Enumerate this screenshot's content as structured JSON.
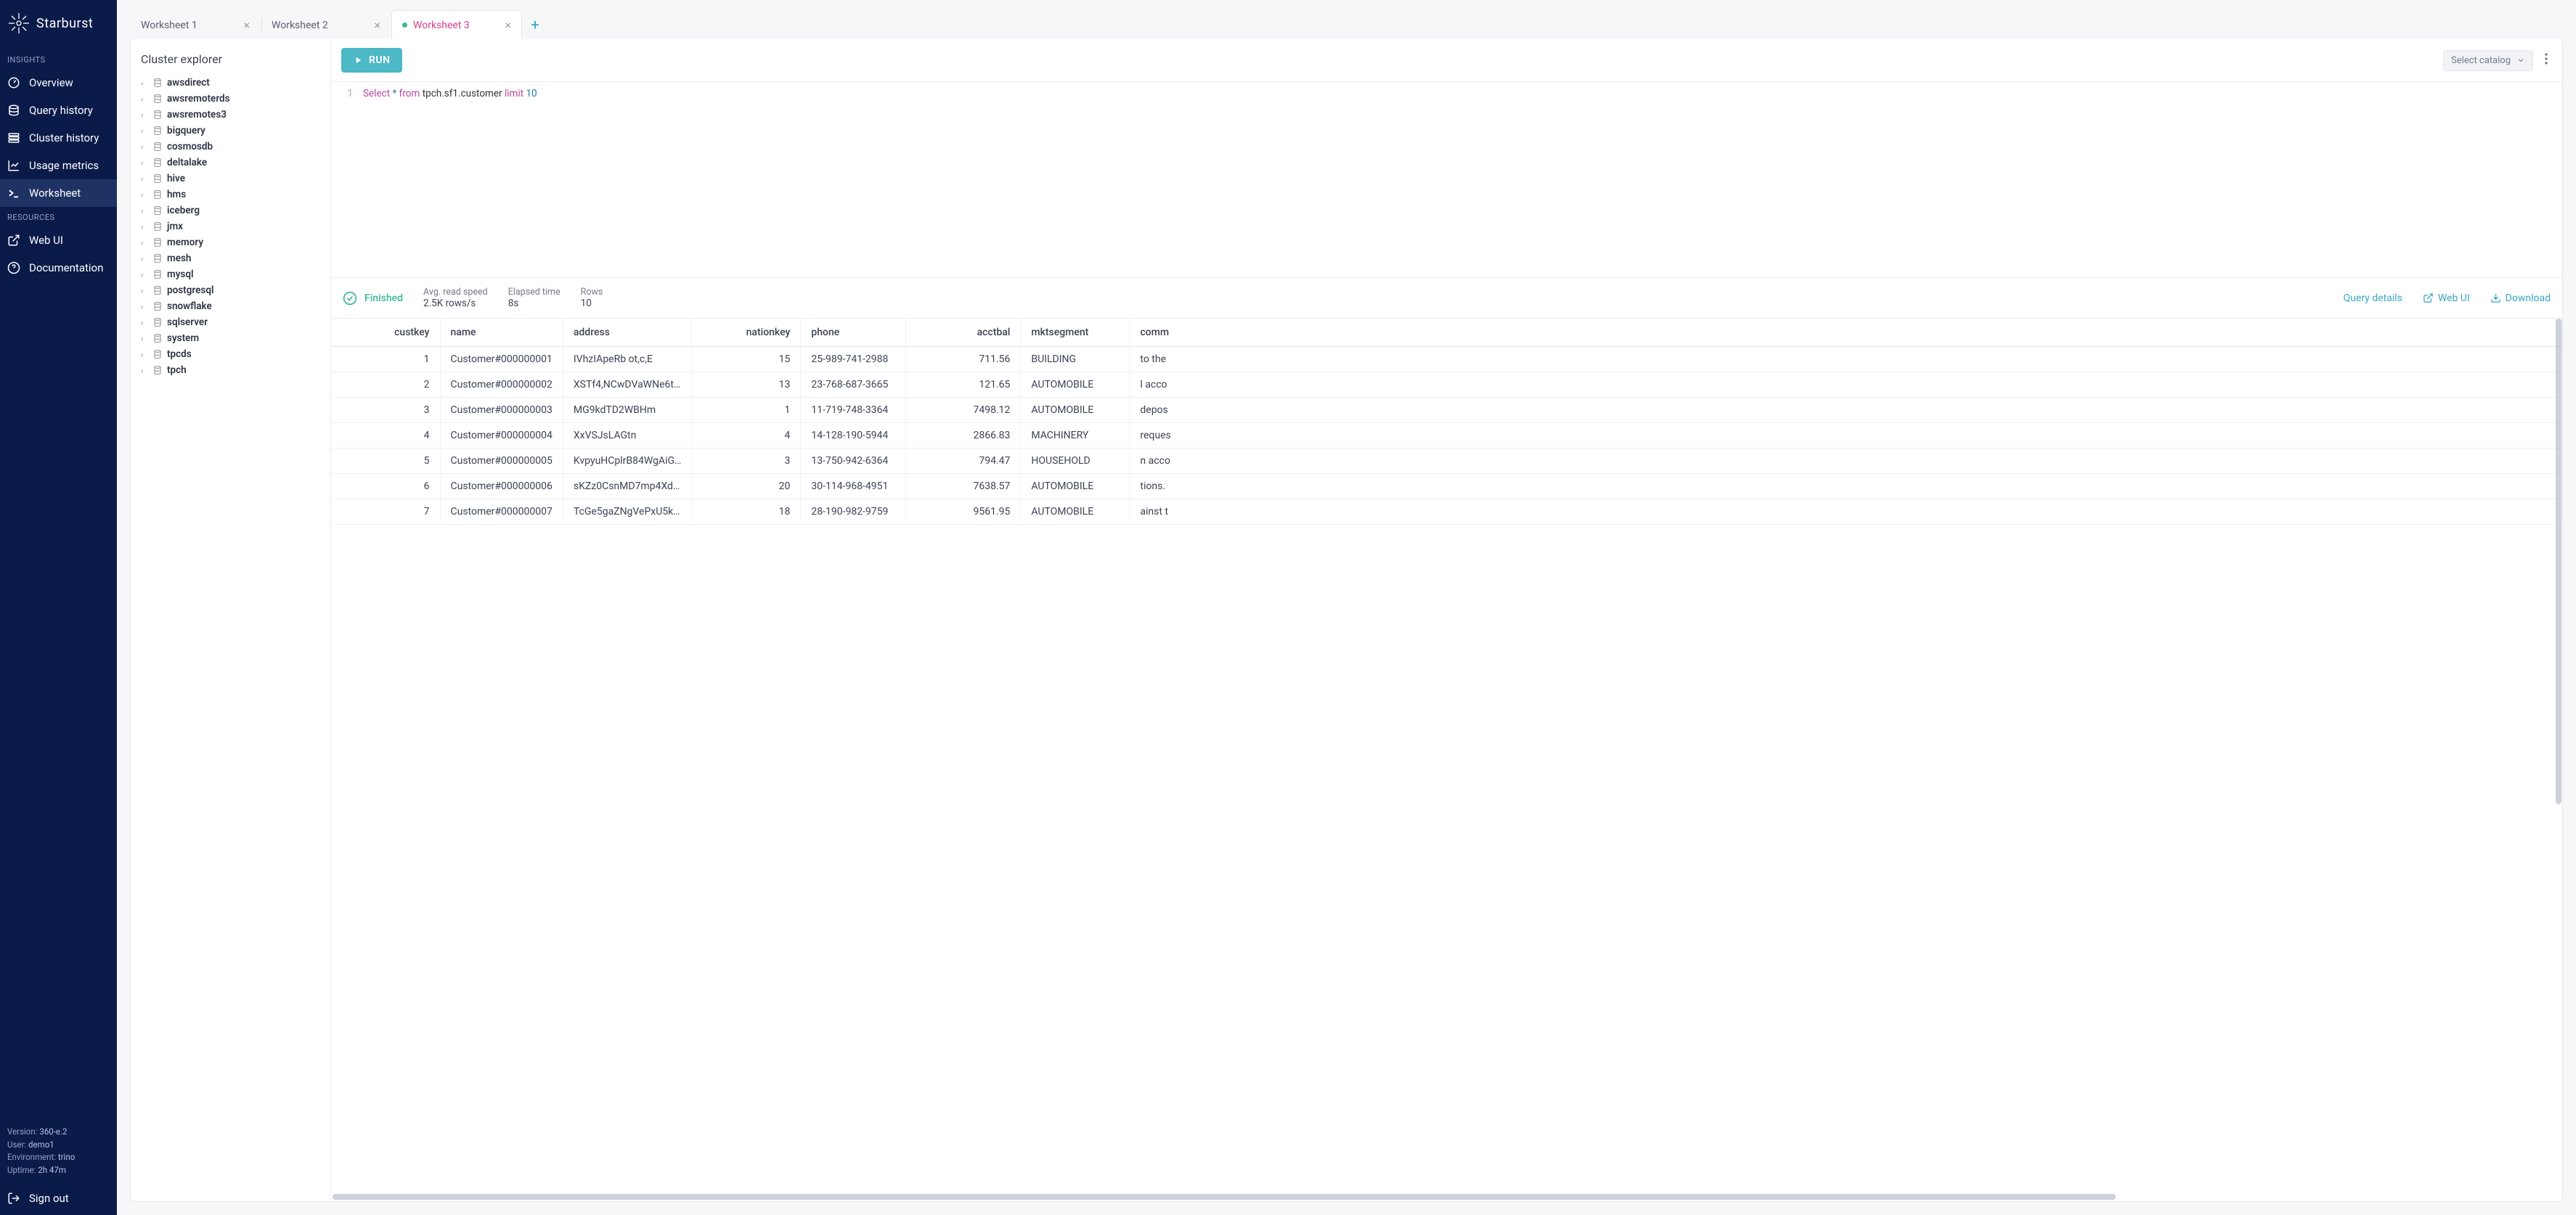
{
  "brand": "Starburst",
  "sidebar": {
    "section_insights": "INSIGHTS",
    "section_resources": "RESOURCES",
    "items_insights": [
      {
        "label": "Overview",
        "icon": "gauge"
      },
      {
        "label": "Query history",
        "icon": "history"
      },
      {
        "label": "Cluster history",
        "icon": "cluster"
      },
      {
        "label": "Usage metrics",
        "icon": "chart"
      },
      {
        "label": "Worksheet",
        "icon": "terminal"
      }
    ],
    "items_resources": [
      {
        "label": "Web UI",
        "icon": "external"
      },
      {
        "label": "Documentation",
        "icon": "help"
      }
    ],
    "footer": {
      "version_label": "Version:",
      "version_value": "360-e.2",
      "user_label": "User:",
      "user_value": "demo1",
      "env_label": "Environment:",
      "env_value": "trino",
      "uptime_label": "Uptime:",
      "uptime_value": "2h 47m"
    },
    "signout": "Sign out"
  },
  "tabs": [
    {
      "label": "Worksheet 1",
      "active": false,
      "modified": false
    },
    {
      "label": "Worksheet 2",
      "active": false,
      "modified": false
    },
    {
      "label": "Worksheet 3",
      "active": true,
      "modified": true
    }
  ],
  "explorer": {
    "title": "Cluster explorer",
    "catalogs": [
      "awsdirect",
      "awsremoterds",
      "awsremotes3",
      "bigquery",
      "cosmosdb",
      "deltalake",
      "hive",
      "hms",
      "iceberg",
      "jmx",
      "memory",
      "mesh",
      "mysql",
      "postgresql",
      "snowflake",
      "sqlserver",
      "system",
      "tpcds",
      "tpch"
    ]
  },
  "toolbar": {
    "run": "RUN",
    "catalog_placeholder": "Select catalog"
  },
  "editor": {
    "line_no": "1",
    "tok_select": "Select",
    "tok_star": "*",
    "tok_from": "from",
    "tok_table": "tpch.sf1.customer",
    "tok_limit": "limit",
    "tok_n": "10"
  },
  "status": {
    "state": "Finished",
    "speed_label": "Avg. read speed",
    "speed_value": "2.5K rows/s",
    "elapsed_label": "Elapsed time",
    "elapsed_value": "8s",
    "rows_label": "Rows",
    "rows_value": "10",
    "details": "Query details",
    "webui": "Web UI",
    "download": "Download"
  },
  "table": {
    "columns": [
      "custkey",
      "name",
      "address",
      "nationkey",
      "phone",
      "acctbal",
      "mktsegment",
      "comm"
    ],
    "rows": [
      {
        "custkey": "1",
        "name": "Customer#000000001",
        "address": "IVhzIApeRb ot,c,E",
        "nationkey": "15",
        "phone": "25-989-741-2988",
        "acctbal": "711.56",
        "mktsegment": "BUILDING",
        "comment": "to the"
      },
      {
        "custkey": "2",
        "name": "Customer#000000002",
        "address": "XSTf4,NCwDVaWNe6t…",
        "nationkey": "13",
        "phone": "23-768-687-3665",
        "acctbal": "121.65",
        "mktsegment": "AUTOMOBILE",
        "comment": "l acco"
      },
      {
        "custkey": "3",
        "name": "Customer#000000003",
        "address": "MG9kdTD2WBHm",
        "nationkey": "1",
        "phone": "11-719-748-3364",
        "acctbal": "7498.12",
        "mktsegment": "AUTOMOBILE",
        "comment": "depos"
      },
      {
        "custkey": "4",
        "name": "Customer#000000004",
        "address": "XxVSJsLAGtn",
        "nationkey": "4",
        "phone": "14-128-190-5944",
        "acctbal": "2866.83",
        "mktsegment": "MACHINERY",
        "comment": "reques"
      },
      {
        "custkey": "5",
        "name": "Customer#000000005",
        "address": "KvpyuHCplrB84WgAiG…",
        "nationkey": "3",
        "phone": "13-750-942-6364",
        "acctbal": "794.47",
        "mktsegment": "HOUSEHOLD",
        "comment": "n acco"
      },
      {
        "custkey": "6",
        "name": "Customer#000000006",
        "address": "sKZz0CsnMD7mp4Xd…",
        "nationkey": "20",
        "phone": "30-114-968-4951",
        "acctbal": "7638.57",
        "mktsegment": "AUTOMOBILE",
        "comment": "tions."
      },
      {
        "custkey": "7",
        "name": "Customer#000000007",
        "address": "TcGe5gaZNgVePxU5k…",
        "nationkey": "18",
        "phone": "28-190-982-9759",
        "acctbal": "9561.95",
        "mktsegment": "AUTOMOBILE",
        "comment": "ainst t"
      }
    ]
  }
}
